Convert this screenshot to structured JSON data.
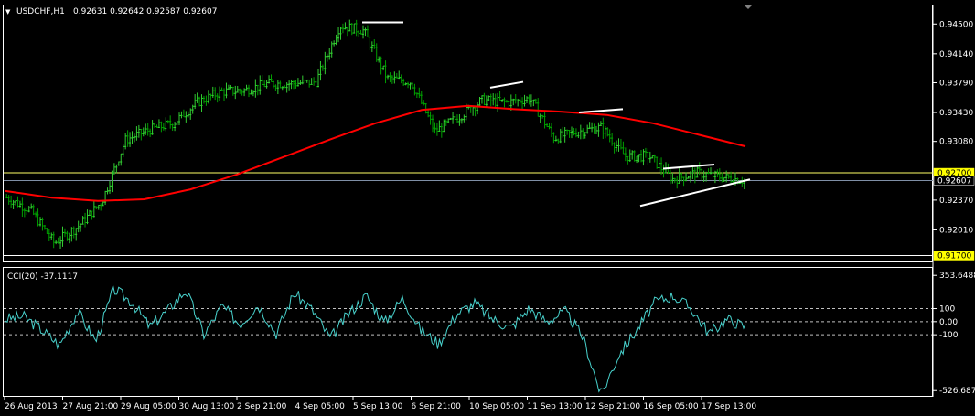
{
  "header": {
    "menu_glyph": "▼",
    "symbol": "USDCHF,H1",
    "ohlc": "0.92631 0.92642 0.92587 0.92607"
  },
  "indicator": {
    "title": "CCI(20) -37.1117"
  },
  "colors": {
    "background": "#000000",
    "frame": "#ffffff",
    "candle_up": "#32cd32",
    "candle_down": "#00a000",
    "moving_average": "#ff0000",
    "cci_line": "#48d1cc",
    "level_line": "#ffff66",
    "trend_lines": "#ffffff",
    "price_tag": "#ffff00"
  },
  "price_axis": {
    "ticks": [
      {
        "value": 0.945,
        "label": "0.94500"
      },
      {
        "value": 0.9414,
        "label": "0.94140"
      },
      {
        "value": 0.9379,
        "label": "0.93790"
      },
      {
        "value": 0.9343,
        "label": "0.93430"
      },
      {
        "value": 0.9308,
        "label": "0.93080"
      },
      {
        "value": 0.9237,
        "label": "0.92370"
      },
      {
        "value": 0.9201,
        "label": "0.92010"
      }
    ],
    "tags": [
      {
        "value": 0.927,
        "label": "0.92700",
        "bg": "#ffff00",
        "fg": "#000000"
      },
      {
        "value": 0.92607,
        "label": "0.92607",
        "bg": "#000000",
        "fg": "#ffffff"
      },
      {
        "value": 0.917,
        "label": "0.91700",
        "bg": "#ffff00",
        "fg": "#000000"
      }
    ],
    "range": [
      0.9165,
      0.9468
    ]
  },
  "cci_axis": {
    "ticks": [
      {
        "value": 353.6488,
        "label": "353.6488"
      },
      {
        "value": 100,
        "label": "100"
      },
      {
        "value": 0,
        "label": "0.00"
      },
      {
        "value": -100,
        "label": "-100"
      },
      {
        "value": -526.6871,
        "label": "-526.6871"
      }
    ],
    "range": [
      -560,
      390
    ]
  },
  "time_axis": [
    "26 Aug 2013",
    "27 Aug 21:00",
    "29 Aug 05:00",
    "30 Aug 13:00",
    "2 Sep 21:00",
    "4 Sep 05:00",
    "5 Sep 13:00",
    "6 Sep 21:00",
    "10 Sep 05:00",
    "11 Sep 13:00",
    "12 Sep 21:00",
    "16 Sep 05:00",
    "17 Sep 13:00"
  ],
  "chart_data": {
    "type": "line",
    "title": "USDCHF,H1",
    "xlabel": "",
    "ylabel": "",
    "x_categories": [
      "26 Aug 2013",
      "27 Aug 21:00",
      "29 Aug 05:00",
      "30 Aug 13:00",
      "2 Sep 21:00",
      "4 Sep 05:00",
      "5 Sep 13:00",
      "6 Sep 21:00",
      "10 Sep 05:00",
      "11 Sep 13:00",
      "12 Sep 21:00",
      "16 Sep 05:00",
      "17 Sep 13:00"
    ],
    "ylim": [
      0.9165,
      0.9468
    ],
    "grid": false,
    "series": [
      {
        "style": "price",
        "values": [
          0.924,
          0.9225,
          0.9185,
          0.9205,
          0.9235,
          0.931,
          0.9322,
          0.933,
          0.9355,
          0.9368,
          0.937,
          0.9378,
          0.9378,
          0.938,
          0.9448,
          0.9442,
          0.9384,
          0.938,
          0.932,
          0.9338,
          0.9358,
          0.9355,
          0.936,
          0.9312,
          0.932,
          0.9325,
          0.929,
          0.929,
          0.9262,
          0.927,
          0.9265,
          0.9261
        ]
      },
      {
        "style": "moving_average",
        "values": [
          0.9248,
          0.924,
          0.9236,
          0.9238,
          0.925,
          0.9268,
          0.9289,
          0.931,
          0.933,
          0.9346,
          0.9351,
          0.9347,
          0.9344,
          0.934,
          0.933,
          0.9316,
          0.9302
        ]
      }
    ],
    "levels": [
      0.927,
      0.92607,
      0.917
    ],
    "annotations": "trend lines drawn on chart",
    "indicator": {
      "name": "CCI(20)",
      "current": -37.1117,
      "levels": [
        100,
        0,
        -100
      ],
      "ylim": [
        -526.6871,
        353.6488
      ],
      "values": [
        20,
        40,
        -60,
        -180,
        80,
        -150,
        250,
        150,
        -40,
        90,
        240,
        -100,
        120,
        -20,
        130,
        -90,
        220,
        90,
        -130,
        60,
        200,
        -10,
        180,
        -60,
        -170,
        60,
        140,
        20,
        -50,
        100,
        0,
        80,
        -120,
        -560,
        -250,
        -60,
        150,
        200,
        100,
        -90,
        20,
        -40
      ]
    }
  }
}
